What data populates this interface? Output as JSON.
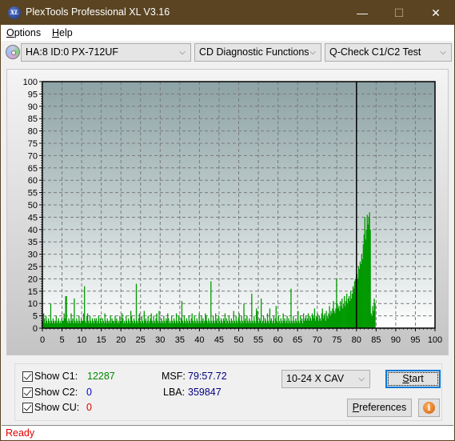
{
  "window": {
    "title": "PlexTools Professional XL V3.16",
    "app_icon_text": "XL",
    "controls": {
      "minimize": "—",
      "maximize": "☐",
      "close": "✕"
    }
  },
  "menu": {
    "items": [
      {
        "label": "Options",
        "accel": "O",
        "rest": "ptions"
      },
      {
        "label": "Help",
        "accel": "H",
        "rest": "elp"
      }
    ]
  },
  "toolbar": {
    "drive": "HA:8 ID:0  PX-712UF",
    "function": "CD Diagnostic Functions",
    "test": "Q-Check C1/C2 Test",
    "chevron": "⌵"
  },
  "chart_data": {
    "type": "bar",
    "title": "",
    "xlabel": "",
    "ylabel": "",
    "xlim": [
      0,
      100
    ],
    "ylim": [
      0,
      100
    ],
    "x_ticks": [
      0,
      5,
      10,
      15,
      20,
      25,
      30,
      35,
      40,
      45,
      50,
      55,
      60,
      65,
      70,
      75,
      80,
      85,
      90,
      95,
      100
    ],
    "y_ticks": [
      0,
      5,
      10,
      15,
      20,
      25,
      30,
      35,
      40,
      45,
      50,
      55,
      60,
      65,
      70,
      75,
      80,
      85,
      90,
      95,
      100
    ],
    "grid": true,
    "cursor_x": 80,
    "series": [
      {
        "name": "C1",
        "color": "#009900",
        "x_step": 0.2,
        "values": [
          3,
          6,
          4,
          2,
          5,
          3,
          2,
          4,
          3,
          2,
          10,
          3,
          2,
          4,
          3,
          2,
          3,
          5,
          2,
          3,
          4,
          2,
          3,
          2,
          4,
          3,
          3,
          6,
          4,
          13,
          13,
          3,
          2,
          4,
          3,
          2,
          6,
          3,
          4,
          2,
          12,
          3,
          2,
          4,
          3,
          2,
          5,
          3,
          2,
          4,
          3,
          3,
          6,
          17,
          3,
          2,
          5,
          6,
          3,
          2,
          5,
          3,
          2,
          4,
          3,
          2,
          4,
          3,
          4,
          2,
          3,
          5,
          2,
          4,
          3,
          2,
          4,
          3,
          2,
          6,
          3,
          2,
          4,
          3,
          2,
          3,
          5,
          2,
          4,
          3,
          3,
          2,
          5,
          3,
          4,
          2,
          3,
          2,
          5,
          3,
          3,
          6,
          4,
          2,
          3,
          2,
          5,
          3,
          2,
          4,
          3,
          2,
          7,
          5,
          3,
          2,
          4,
          3,
          2,
          18,
          3,
          2,
          4,
          6,
          3,
          2,
          5,
          3,
          2,
          7,
          3,
          4,
          2,
          3,
          5,
          2,
          3,
          4,
          6,
          3,
          2,
          5,
          3,
          2,
          4,
          6,
          3,
          2,
          7,
          3,
          2,
          4,
          3,
          2,
          5,
          3,
          2,
          4,
          3,
          6,
          4,
          2,
          3,
          2,
          5,
          3,
          2,
          4,
          3,
          2,
          6,
          3,
          2,
          5,
          3,
          2,
          4,
          11,
          3,
          2,
          5,
          3,
          2,
          4,
          3,
          2,
          5,
          3,
          2,
          4,
          6,
          3,
          2,
          5,
          3,
          2,
          4,
          3,
          2,
          6,
          3,
          2,
          5,
          3,
          4,
          2,
          3,
          6,
          5,
          3,
          2,
          4,
          3,
          2,
          19,
          3,
          2,
          5,
          3,
          2,
          6,
          3,
          4,
          2,
          5,
          3,
          2,
          4,
          3,
          2,
          4,
          3,
          6,
          2,
          4,
          3,
          2,
          5,
          3,
          2,
          4,
          3,
          2,
          7,
          3,
          2,
          5,
          3,
          2,
          4,
          6,
          3,
          2,
          5,
          3,
          2,
          10,
          3,
          4,
          2,
          5,
          3,
          2,
          4,
          3,
          2,
          14,
          3,
          2,
          5,
          3,
          2,
          8,
          7,
          3,
          2,
          4,
          3,
          12,
          2,
          3,
          5,
          2,
          4,
          3,
          2,
          6,
          3,
          2,
          8,
          3,
          4,
          2,
          3,
          5,
          2,
          4,
          9,
          3,
          2,
          5,
          3,
          2,
          4,
          3,
          2,
          6,
          3,
          4,
          2,
          3,
          5,
          2,
          4,
          3,
          2,
          16,
          3,
          2,
          5,
          3,
          2,
          4,
          3,
          2,
          7,
          3,
          2,
          5,
          3,
          4,
          2,
          6,
          3,
          4,
          5,
          3,
          4,
          6,
          3,
          5,
          4,
          3,
          6,
          5,
          4,
          8,
          3,
          5,
          4,
          6,
          3,
          5,
          4,
          3,
          6,
          8,
          4,
          5,
          6,
          3,
          7,
          5,
          4,
          6,
          9,
          5,
          7,
          6,
          8,
          11,
          7,
          6,
          8,
          20,
          10,
          8,
          9,
          7,
          11,
          9,
          12,
          8,
          10,
          13,
          9,
          11,
          14,
          10,
          12,
          13,
          11,
          15,
          12,
          14,
          17,
          16,
          19,
          20,
          21,
          22,
          20,
          25,
          24,
          27,
          26,
          30,
          28,
          34,
          38,
          45,
          36,
          40,
          46,
          42,
          45,
          47,
          40,
          6,
          5,
          9,
          7,
          12,
          10
        ]
      }
    ]
  },
  "stats": {
    "show_c1_label": "Show C1:",
    "show_c2_label": "Show C2:",
    "show_cu_label": "Show CU:",
    "c1_value": "12287",
    "c2_value": "0",
    "cu_value": "0",
    "c1_color": "#008800",
    "c2_color": "#0000cc",
    "cu_color": "#e00000",
    "msf_label": "MSF:",
    "msf_value": "79:57.72",
    "lba_label": "LBA:",
    "lba_value": "359847",
    "value_color": "#000080"
  },
  "actions": {
    "speed": "10-24 X CAV",
    "start_accel": "S",
    "start_rest": "tart",
    "prefs_accel": "P",
    "prefs_rest": "references",
    "info_glyph": "i"
  },
  "status": {
    "text": "Ready"
  }
}
